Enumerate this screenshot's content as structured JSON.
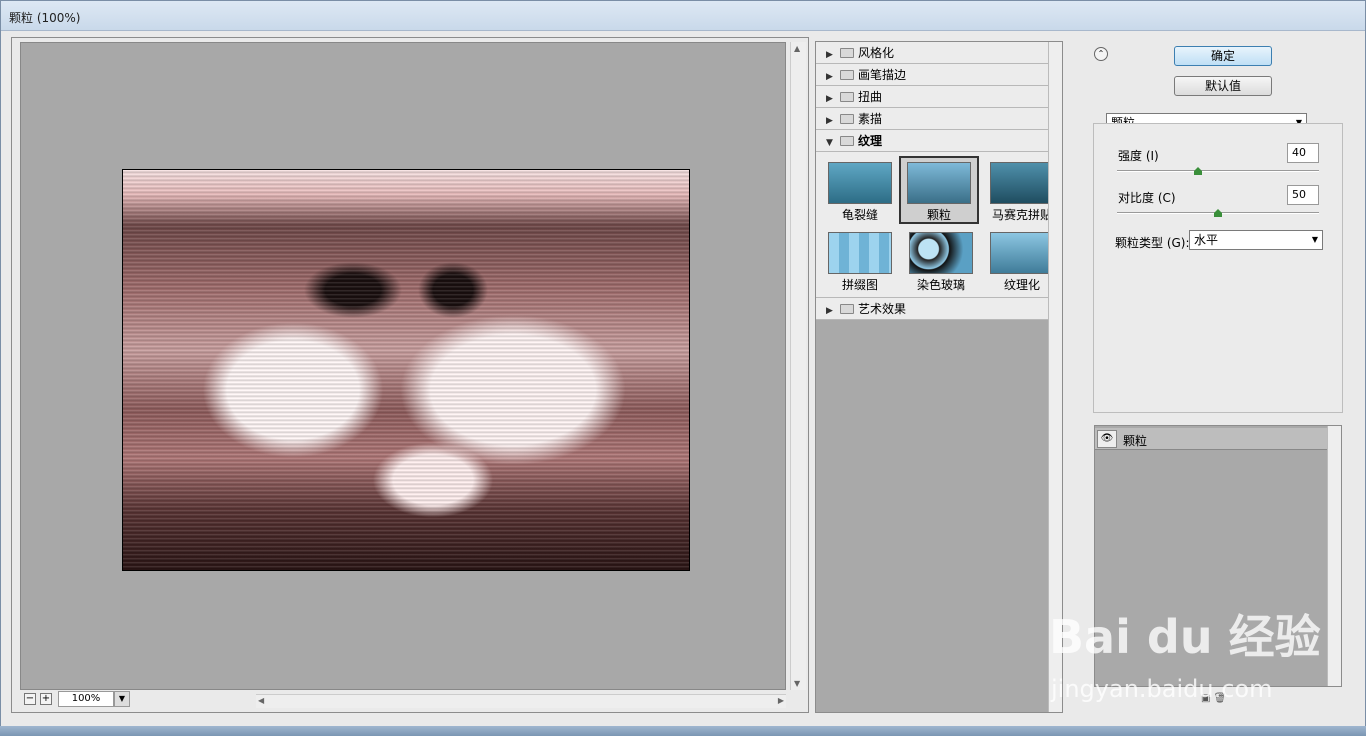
{
  "window": {
    "title": "颗粒 (100%)"
  },
  "preview": {
    "zoom": "100%"
  },
  "gallery": {
    "categories_top": [
      {
        "label": "风格化"
      },
      {
        "label": "画笔描边"
      },
      {
        "label": "扭曲"
      },
      {
        "label": "素描"
      }
    ],
    "open_category": {
      "label": "纹理"
    },
    "thumbnails": [
      {
        "label": "龟裂缝"
      },
      {
        "label": "颗粒"
      },
      {
        "label": "马赛克拼贴"
      },
      {
        "label": "拼缀图"
      },
      {
        "label": "染色玻璃"
      },
      {
        "label": "纹理化"
      }
    ],
    "selected": "颗粒",
    "categories_bottom": [
      {
        "label": "艺术效果"
      }
    ]
  },
  "buttons": {
    "ok": "确定",
    "default": "默认值"
  },
  "settings": {
    "filter": "颗粒",
    "intensity_label": "强度 (I)",
    "intensity_value": "40",
    "contrast_label": "对比度 (C)",
    "contrast_value": "50",
    "grain_type_label": "颗粒类型 (G):",
    "grain_type_value": "水平"
  },
  "layers": {
    "items": [
      {
        "label": "颗粒"
      }
    ]
  },
  "watermark": {
    "line1": "Bai du 经验",
    "line2": "jingyan.baidu.com"
  }
}
